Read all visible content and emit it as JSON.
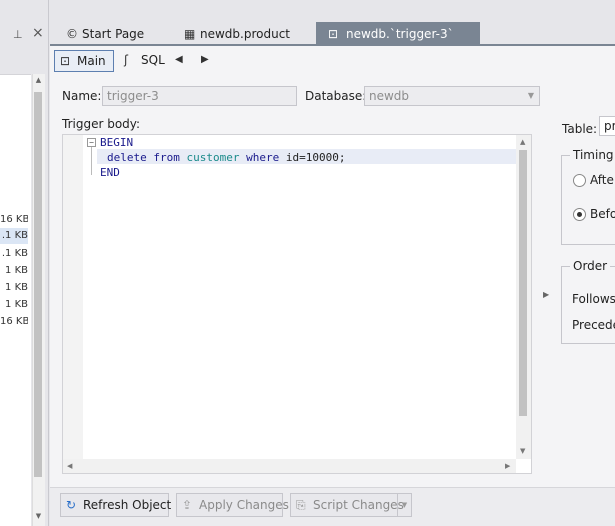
{
  "left_panel": {
    "sizes": [
      "16 KB",
      ".1 KB",
      ".1 KB",
      "1 KB",
      "1 KB",
      "1 KB",
      "16 KB"
    ],
    "selected_index": 1
  },
  "tabs": [
    {
      "label": "Start Page",
      "icon": "start-page-icon"
    },
    {
      "label": "newdb.product",
      "icon": "table-icon"
    },
    {
      "label": "newdb.`trigger-3`",
      "icon": "trigger-icon",
      "active": true
    }
  ],
  "toolbar": {
    "main_label": "Main",
    "sql_label": "SQL",
    "prev_glyph": "◀",
    "next_glyph": "▶"
  },
  "form": {
    "name_label": "Name:",
    "name_value": "trigger-3",
    "database_label": "Database:",
    "database_value": "newdb",
    "trigger_body_label": "Trigger body:",
    "table_label": "Table:",
    "table_value": "pr"
  },
  "code": {
    "line1": "BEGIN",
    "line2_kw1": "delete from",
    "line2_ident": "customer",
    "line2_kw2": "where",
    "line2_rest": "id=10000;",
    "line3": "END"
  },
  "timing": {
    "title": "Timing",
    "after_label": "Afte",
    "before_label": "Befo",
    "selected": "before"
  },
  "order": {
    "title": "Order",
    "follows_label": "Follows",
    "precedes_label": "Precede"
  },
  "bottom": {
    "refresh_label": "Refresh Object",
    "apply_label": "Apply Changes",
    "script_label": "Script Changes"
  },
  "colors": {
    "active_tab": "#7a8593",
    "keyword": "#1a1a8c",
    "identifier": "#1a8a8a",
    "accent_blue": "#2a6fc9"
  }
}
